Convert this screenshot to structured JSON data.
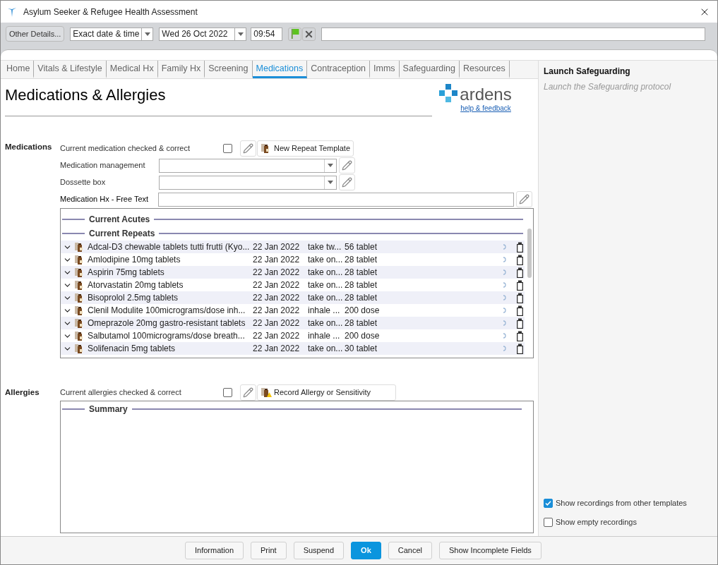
{
  "window": {
    "title": "Asylum Seeker & Refugee Health Assessment"
  },
  "toolbar": {
    "other_details_button": "Other Details...",
    "date_mode": "Exact date & time",
    "date": "Wed 26 Oct 2022",
    "time": "09:54"
  },
  "tabs": [
    {
      "label": "Home",
      "selected": false
    },
    {
      "label": "Vitals & Lifestyle",
      "selected": false
    },
    {
      "label": "Medical Hx",
      "selected": false
    },
    {
      "label": "Family Hx",
      "selected": false
    },
    {
      "label": "Screening",
      "selected": false
    },
    {
      "label": "Medications",
      "selected": true
    },
    {
      "label": "Contraception",
      "selected": false
    },
    {
      "label": "Imms",
      "selected": false
    },
    {
      "label": "Safeguarding",
      "selected": false
    },
    {
      "label": "Resources",
      "selected": false
    }
  ],
  "page": {
    "title": "Medications & Allergies",
    "logo_text": "ardens",
    "help_link": "help & feedback"
  },
  "medications": {
    "label": "Medications",
    "check": {
      "label": "Current medication checked & correct",
      "checked": false
    },
    "template_button": "New Repeat Template",
    "fields": [
      {
        "kind": "dropdown",
        "label": "Medication management"
      },
      {
        "kind": "dropdown",
        "label": "Dossette box"
      },
      {
        "kind": "text",
        "label": "Medication Hx - Free Text"
      }
    ],
    "sections": [
      {
        "title": "Current Acutes"
      },
      {
        "title": "Current Repeats",
        "rows": [
          {
            "name": "Adcal-D3 chewable tablets tutti frutti (Kyo...",
            "date": "22 Jan 2022",
            "dosage": "take tw...",
            "quantity": "56 tablet"
          },
          {
            "name": "Amlodipine 10mg tablets",
            "date": "22 Jan 2022",
            "dosage": "take on...",
            "quantity": "28 tablet"
          },
          {
            "name": "Aspirin 75mg tablets",
            "date": "22 Jan 2022",
            "dosage": "take on...",
            "quantity": "28 tablet"
          },
          {
            "name": "Atorvastatin 20mg tablets",
            "date": "22 Jan 2022",
            "dosage": "take on...",
            "quantity": "28 tablet"
          },
          {
            "name": "Bisoprolol 2.5mg tablets",
            "date": "22 Jan 2022",
            "dosage": "take on...",
            "quantity": "28 tablet"
          },
          {
            "name": "Clenil Modulite 100micrograms/dose inh...",
            "date": "22 Jan 2022",
            "dosage": "inhale ...",
            "quantity": "200 dose"
          },
          {
            "name": "Omeprazole 20mg gastro-resistant tablets",
            "date": "22 Jan 2022",
            "dosage": "take on...",
            "quantity": "28 tablet"
          },
          {
            "name": "Salbutamol 100micrograms/dose breath...",
            "date": "22 Jan 2022",
            "dosage": "inhale ...",
            "quantity": "200 dose"
          },
          {
            "name": "Solifenacin 5mg tablets",
            "date": "22 Jan 2022",
            "dosage": "take on...",
            "quantity": "30 tablet"
          }
        ]
      }
    ]
  },
  "allergies": {
    "label": "Allergies",
    "check": {
      "label": "Current allergies checked & correct",
      "checked": false
    },
    "record_button": "Record Allergy or Sensitivity",
    "sections": [
      {
        "title": "Summary"
      }
    ]
  },
  "side_panel": {
    "title": "Launch Safeguarding",
    "subtitle": "Launch the Safeguarding protocol",
    "options": [
      {
        "label": "Show recordings from other templates",
        "checked": true
      },
      {
        "label": "Show empty recordings",
        "checked": false
      }
    ]
  },
  "buttons": [
    {
      "label": "Information",
      "primary": false
    },
    {
      "label": "Print",
      "primary": false
    },
    {
      "label": "Suspend",
      "primary": false
    },
    {
      "label": "Ok",
      "primary": true
    },
    {
      "label": "Cancel",
      "primary": false
    },
    {
      "label": "Show Incomplete Fields",
      "primary": false
    }
  ]
}
